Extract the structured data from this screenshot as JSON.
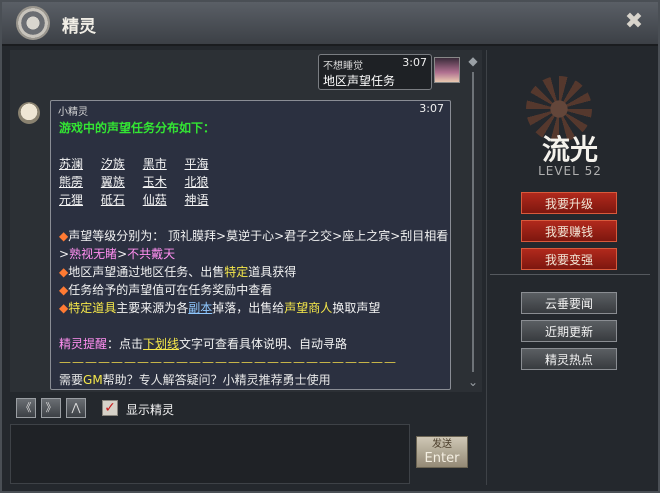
{
  "window": {
    "title": "精灵"
  },
  "user_message": {
    "nick": "不想睡觉",
    "time": "3:07",
    "text": "地区声望任务"
  },
  "bot_message": {
    "nick": "小精灵",
    "time": "3:07",
    "heading": "游戏中的声望任务分布如下：",
    "locations": [
      [
        "苏澜",
        "汐族",
        "黑市",
        "平海"
      ],
      [
        "熊雳",
        "翼族",
        "玉木",
        "北狼"
      ],
      [
        "元狸",
        "砥石",
        "仙菇",
        "神语"
      ]
    ],
    "level_line_pre": "声望等级分别为： 顶礼膜拜>莫逆于心>君子之交>座上之宾>刮目相看>",
    "level_pink": "熟视无睹",
    "level_gt": ">",
    "level_pink2": "不共戴天",
    "line2_pre": "地区声望通过地区任务、出售",
    "line2_yellow": "特定",
    "line2_post": "道具获得",
    "line3": "任务给予的声望值可在任务奖励中查看",
    "line4_a": "特定道具",
    "line4_b": "主要来源为各",
    "line4_c": "副本",
    "line4_d": "掉落，出售给",
    "line4_e": "声望商人",
    "line4_f": "换取声望",
    "tip_label": "精灵提醒",
    "tip_mid": "：点击",
    "tip_link": "下划线",
    "tip_post": "文字可查看具体说明、自动寻路",
    "divider": "——————————————————————————",
    "gm_pre": "需要",
    "gm_yellow": "GM",
    "gm_post": "帮助？专人解答疑问？小精灵推荐勇士使用"
  },
  "profile": {
    "name": "流光",
    "level": "LEVEL 52"
  },
  "red_buttons": [
    "我要升级",
    "我要赚钱",
    "我要变强"
  ],
  "grey_buttons": [
    "云垂要闻",
    "近期更新",
    "精灵热点"
  ],
  "toolbar": {
    "prev": "《",
    "next": "》",
    "top": "⋀",
    "show_label": "显示精灵",
    "checked": "✓"
  },
  "send": {
    "line1": "发送",
    "line2": "Enter"
  },
  "icons": {
    "close": "✖"
  }
}
